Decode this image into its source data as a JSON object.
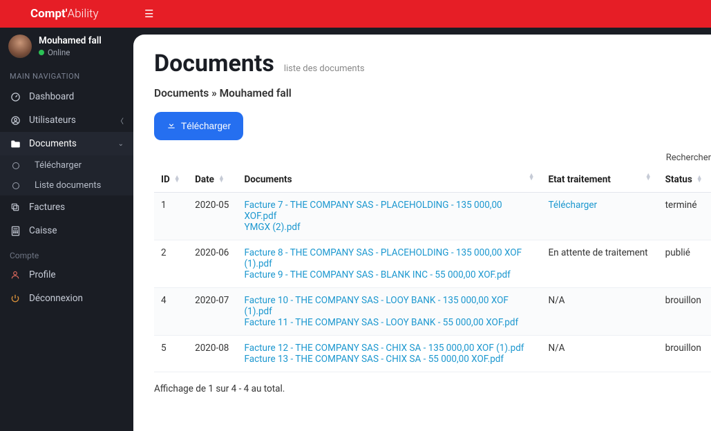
{
  "brand": {
    "bold": "Compt'",
    "light": "Ability"
  },
  "user": {
    "name": "Mouhamed fall",
    "status": "Online"
  },
  "nav": {
    "heading": "MAIN NAVIGATION",
    "dashboard": "Dashboard",
    "users": "Utilisateurs",
    "documents": "Documents",
    "doc_sub_download": "Télécharger",
    "doc_sub_list": "Liste documents",
    "invoices": "Factures",
    "cash": "Caisse",
    "account_heading": "Compte",
    "profile": "Profile",
    "logout": "Déconnexion"
  },
  "page": {
    "title": "Documents",
    "subtitle": "liste des documents",
    "breadcrumb": "Documents » Mouhamed fall",
    "download_btn": "Télécharger",
    "search_label": "Rechercher"
  },
  "table": {
    "cols": {
      "id": "ID",
      "date": "Date",
      "docs": "Documents",
      "etat": "Etat traitement",
      "status": "Status"
    },
    "rows": [
      {
        "id": "1",
        "date": "2020-05",
        "docs": [
          "Facture 7 - THE COMPANY SAS - PLACEHOLDING - 135 000,00 XOF.pdf",
          "YMGX (2).pdf"
        ],
        "etat": "Télécharger",
        "etat_link": true,
        "status": "terminé"
      },
      {
        "id": "2",
        "date": "2020-06",
        "docs": [
          "Facture 8 - THE COMPANY SAS - PLACEHOLDING - 135 000,00 XOF (1).pdf",
          "Facture 9 - THE COMPANY SAS - BLANK INC - 55 000,00 XOF.pdf"
        ],
        "etat": "En attente de traitement",
        "etat_link": false,
        "status": "publié"
      },
      {
        "id": "4",
        "date": "2020-07",
        "docs": [
          "Facture 10 - THE COMPANY SAS - LOOY BANK - 135 000,00 XOF (1).pdf",
          "Facture 11 - THE COMPANY SAS - LOOY BANK - 55 000,00 XOF.pdf"
        ],
        "etat": "N/A",
        "etat_link": false,
        "status": "brouillon"
      },
      {
        "id": "5",
        "date": "2020-08",
        "docs": [
          "Facture 12 - THE COMPANY SAS - CHIX SA - 135 000,00 XOF (1).pdf",
          "Facture 13 - THE COMPANY SAS - CHIX SA - 55 000,00 XOF.pdf"
        ],
        "etat": "N/A",
        "etat_link": false,
        "status": "brouillon"
      }
    ],
    "footer": "Affichage de 1 sur 4 - 4 au total."
  }
}
